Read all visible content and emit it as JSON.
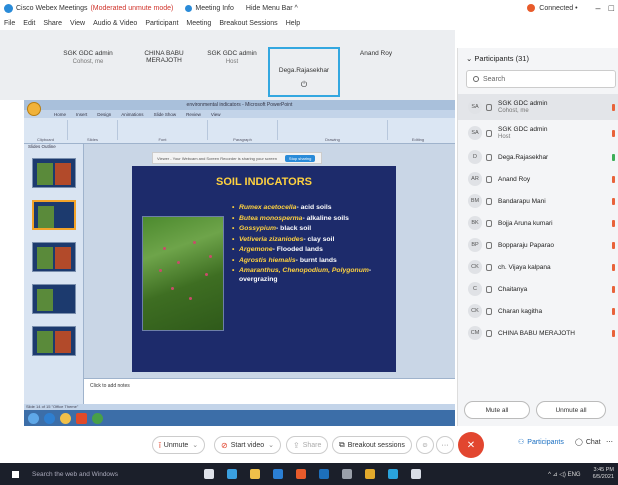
{
  "titlebar": {
    "app": "Cisco Webex Meetings",
    "mode": "(Moderated unmute mode)",
    "meeting_info": "Meeting Info",
    "hide_menu": "Hide Menu Bar ^",
    "connection": "Connected •",
    "minimize": "–",
    "close": "□"
  },
  "menubar": [
    "File",
    "Edit",
    "Share",
    "View",
    "Audio & Video",
    "Participant",
    "Meeting",
    "Breakout Sessions",
    "Help"
  ],
  "strip": {
    "tiles": [
      {
        "name": "SGK GDC admin",
        "sub": "Cohost, me"
      },
      {
        "name": "CHINA BABU MERAJOTH",
        "sub": ""
      },
      {
        "name": "SGK GDC admin",
        "sub": "Host"
      },
      {
        "name": "Dega.Rajasekhar",
        "sub": ""
      },
      {
        "name": "Anand Roy",
        "sub": ""
      }
    ]
  },
  "panel": {
    "header": "Participants (31)",
    "search_placeholder": "Search",
    "participants": [
      {
        "initials": "SA",
        "name": "SGK GDC admin",
        "sub": "Cohost, me",
        "mic": "red"
      },
      {
        "initials": "SA",
        "name": "SGK GDC admin",
        "sub": "Host",
        "mic": "red"
      },
      {
        "initials": "D",
        "name": "Dega.Rajasekhar",
        "sub": "",
        "mic": "green"
      },
      {
        "initials": "AR",
        "name": "Anand Roy",
        "sub": "",
        "mic": "red"
      },
      {
        "initials": "BM",
        "name": "Bandarapu Mani",
        "sub": "",
        "mic": "red"
      },
      {
        "initials": "BK",
        "name": "Bojja Aruna kumari",
        "sub": "",
        "mic": "red"
      },
      {
        "initials": "BP",
        "name": "Bopparaju Paparao",
        "sub": "",
        "mic": "red"
      },
      {
        "initials": "CK",
        "name": "ch. Vijaya kalpana",
        "sub": "",
        "mic": "red"
      },
      {
        "initials": "C",
        "name": "Chaitanya",
        "sub": "",
        "mic": "red"
      },
      {
        "initials": "CK",
        "name": "Charan kagitha",
        "sub": "",
        "mic": "red"
      },
      {
        "initials": "CM",
        "name": "CHINA BABU MERAJOTH",
        "sub": "",
        "mic": "red"
      }
    ],
    "mute_all": "Mute all",
    "unmute_all": "Unmute all"
  },
  "ppt": {
    "window_title": "environmental indicators - Microsoft PowerPoint",
    "tabs": [
      "Home",
      "Insert",
      "Design",
      "Animations",
      "Slide Show",
      "Review",
      "View"
    ],
    "groups": [
      "Clipboard",
      "Slides",
      "Font",
      "Paragraph",
      "Drawing",
      "Editing"
    ],
    "left_tabs": "Slides   Outline",
    "notes_placeholder": "Click to add notes",
    "share_banner": "Viewer - Your Webcam and Screen Recorder is sharing your screen",
    "stop_sharing": "Stop sharing",
    "status": "Slide 14 of 15   \"Office Theme\""
  },
  "slide": {
    "title": "SOIL INDICATORS",
    "bullets": [
      {
        "species": "Rumex acetocella",
        "text": "- acid soils"
      },
      {
        "species": "Butea  monosperma",
        "text": "- alkaline soils"
      },
      {
        "species": "Gossypium",
        "text": "- black soil"
      },
      {
        "species": "Vetiveria zizaniodes",
        "text": "- clay soil"
      },
      {
        "species": "Argemone",
        "text": "- Flooded lands"
      },
      {
        "species": "Agrostis  hiemalis",
        "text": "- burnt lands"
      },
      {
        "species": "Amaranthus, Chenopodium, Polygonum",
        "text": "- overgrazing"
      }
    ]
  },
  "controls": {
    "unmute": "Unmute",
    "start_video": "Start video",
    "share": "Share",
    "breakout": "Breakout sessions",
    "participants": "Participants",
    "chat": "Chat",
    "more": "···"
  },
  "taskbar": {
    "search": "Search the web and Windows",
    "tray": "^  ⊿  ◁)  ENG",
    "time": "3:45 PM",
    "date": "6/5/2021"
  },
  "colors": {
    "accent": "#2a8bd8",
    "end_call": "#e2462f",
    "slide_bg": "#1d2b6b",
    "slide_title": "#ffd23f"
  }
}
